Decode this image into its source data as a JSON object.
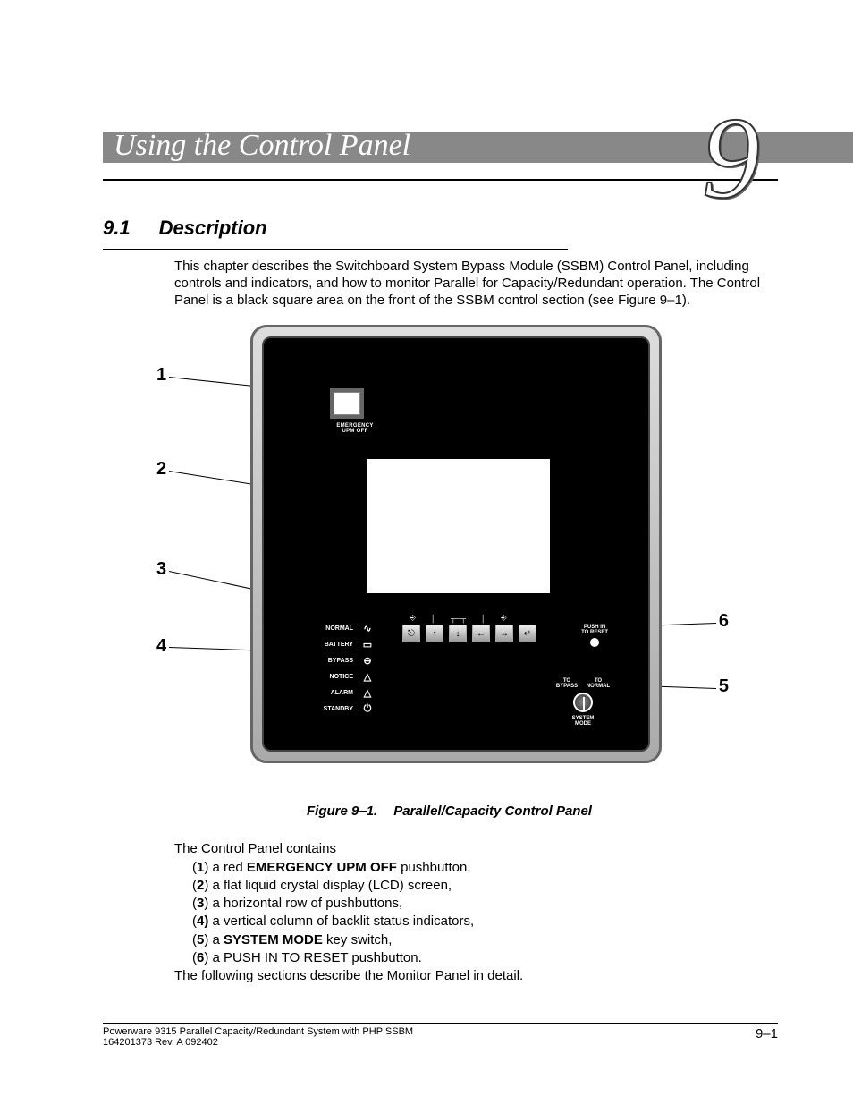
{
  "chapter": {
    "title": "Using the Control Panel",
    "number": "9"
  },
  "section": {
    "num": "9.1",
    "title": "Description"
  },
  "intro": "This chapter describes the Switchboard System Bypass Module (SSBM) Control Panel, including controls and indicators, and how to monitor Parallel for Capacity/Redundant operation. The Control Panel is a black square area on the front of the SSBM control section (see Figure 9‒1).",
  "panel": {
    "epo_line1": "EMERGENCY",
    "epo_line2": "UPM OFF",
    "status": [
      {
        "label": "NORMAL",
        "icon": "∿"
      },
      {
        "label": "BATTERY",
        "icon": "▭"
      },
      {
        "label": "BYPASS",
        "icon": "⊖"
      },
      {
        "label": "NOTICE",
        "icon": "△"
      },
      {
        "label": "ALARM",
        "icon": "△"
      },
      {
        "label": "STANDBY",
        "icon": "⏻"
      }
    ],
    "buttons": [
      "⎋",
      "↑",
      "↓",
      "←",
      "→",
      "↵"
    ],
    "push_reset_l1": "PUSH IN",
    "push_reset_l2": "TO RESET",
    "to_bypass": "TO BYPASS",
    "to_normal": "TO NORMAL",
    "system_mode_l1": "SYSTEM",
    "system_mode_l2": "MODE"
  },
  "callouts": [
    "1",
    "2",
    "3",
    "4",
    "5",
    "6"
  ],
  "figure": {
    "label": "Figure 9‒1.",
    "title": "Parallel/Capacity Control Panel"
  },
  "contains_lead": "The Control Panel contains",
  "items": [
    {
      "n": "1",
      "pre": ") a red ",
      "bold": "EMERGENCY UPM OFF",
      "post": " pushbutton,"
    },
    {
      "n": "2",
      "pre": ") a flat liquid crystal display (LCD) screen,",
      "bold": "",
      "post": ""
    },
    {
      "n": "3",
      "pre": ") a horizontal row of pushbuttons,",
      "bold": "",
      "post": ""
    },
    {
      "n": "4",
      "pre": " a vertical column of backlit status indicators,",
      "bold": "",
      "post": "",
      "paren_bold": true
    },
    {
      "n": "5",
      "pre": ") a ",
      "bold": "SYSTEM MODE",
      "post": " key switch,"
    },
    {
      "n": "6",
      "pre": ") a PUSH IN TO RESET pushbutton.",
      "bold": "",
      "post": ""
    }
  ],
  "followup": "The following sections describe the Monitor Panel in detail.",
  "footer": {
    "line1": "Powerware 9315 Parallel Capacity/Redundant System with PHP SSBM",
    "line2": "164201373    Rev. A      092402",
    "page": "9‒1"
  }
}
